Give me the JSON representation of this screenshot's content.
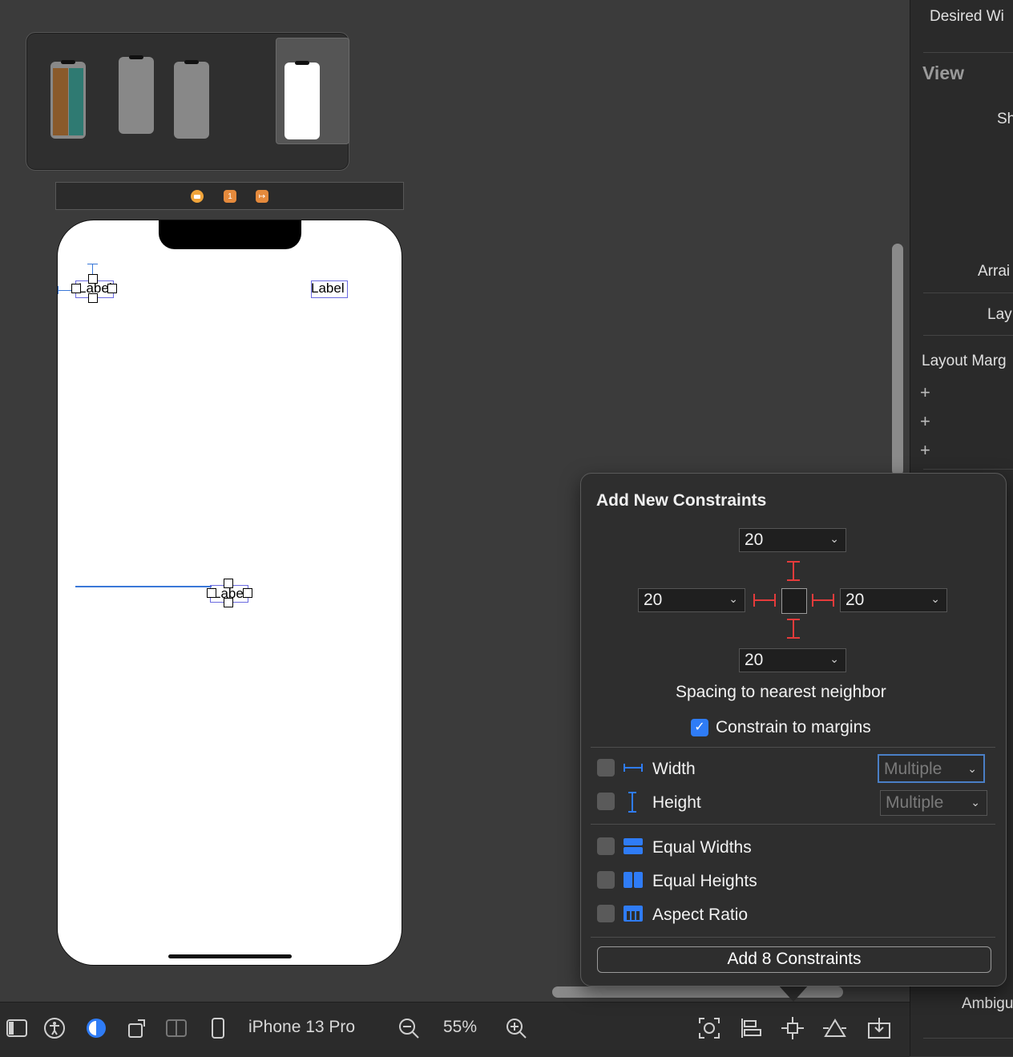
{
  "canvas": {
    "labels": [
      "Label",
      "Label",
      "Label"
    ]
  },
  "toolbar": {
    "device": "iPhone 13 Pro",
    "zoom": "55%"
  },
  "inspector": {
    "desired_width": "Desired Wi",
    "view_header": "View",
    "show": "Sh",
    "arrange": "Arrai",
    "layout": "Lay",
    "layout_margins": "Layout Marg",
    "plus": "+",
    "ambiguity": "Ambigu"
  },
  "popover": {
    "title": "Add New Constraints",
    "top_value": "20",
    "left_value": "20",
    "right_value": "20",
    "bottom_value": "20",
    "spacing_caption": "Spacing to nearest neighbor",
    "constrain_margins_label": "Constrain to margins",
    "constrain_margins_checked": true,
    "width_label": "Width",
    "height_label": "Height",
    "width_multiplier": "Multiple",
    "height_multiplier": "Multiple",
    "equal_widths_label": "Equal Widths",
    "equal_heights_label": "Equal Heights",
    "aspect_ratio_label": "Aspect Ratio",
    "add_button_label": "Add 8 Constraints",
    "accent_color": "#2f7cf6",
    "strut_color": "#e53b3b"
  }
}
